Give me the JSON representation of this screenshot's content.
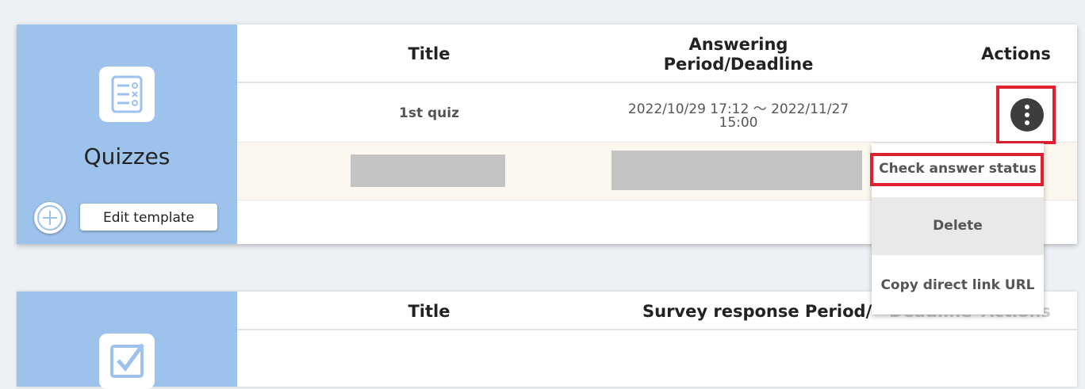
{
  "quizzes": {
    "title": "Quizzes",
    "edit_template": "Edit template",
    "columns": {
      "title": "Title",
      "period_line1": "Answering",
      "period_line2": "Period/Deadline",
      "actions": "Actions"
    },
    "rows": [
      {
        "title": "1st quiz",
        "period_line1": "2022/10/29 17:12 ～ 2022/11/27",
        "period_line2": "15:00"
      }
    ]
  },
  "menu": {
    "items": [
      "Check answer status",
      "Delete",
      "Copy direct link URL"
    ]
  },
  "surveys": {
    "columns": {
      "title": "Title",
      "period_visible": "Survey response Period/",
      "period_obscured": "Deadline",
      "actions": "Actions"
    }
  },
  "colors": {
    "sidebar": "#9dc2ec",
    "highlight": "#e0202e",
    "kebab": "#3d3d3d",
    "row_highlight": "#fcf8ef"
  }
}
